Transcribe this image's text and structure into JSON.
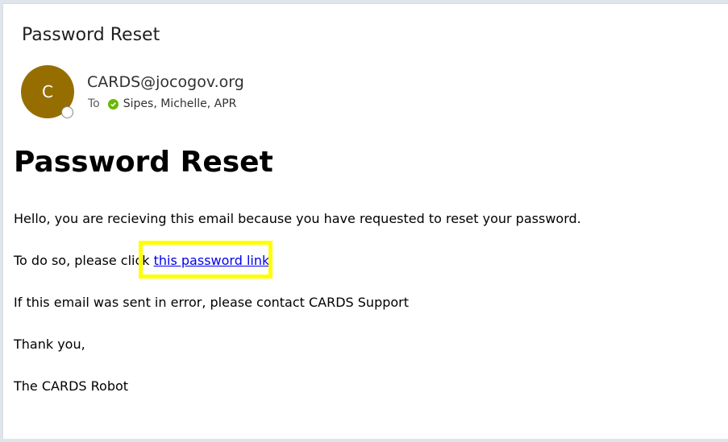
{
  "email": {
    "subject": "Password Reset",
    "avatar_initial": "C",
    "sender": "CARDS@jocogov.org",
    "to_label": "To",
    "recipient": "Sipes, Michelle, APR"
  },
  "body": {
    "heading": "Password Reset",
    "line1": "Hello, you are recieving this email because you have requested to reset your password.",
    "line2_prefix": "To do so, please click ",
    "line2_link": "this password link",
    "line2_suffix": ".",
    "line3": "If this email was sent in error, please contact CARDS Support",
    "line4": "Thank you,",
    "line5": "The CARDS Robot"
  },
  "colors": {
    "avatar_bg": "#966e00",
    "link": "#0000ee",
    "highlight": "#ffff00",
    "presence_check": "#6bb700"
  }
}
